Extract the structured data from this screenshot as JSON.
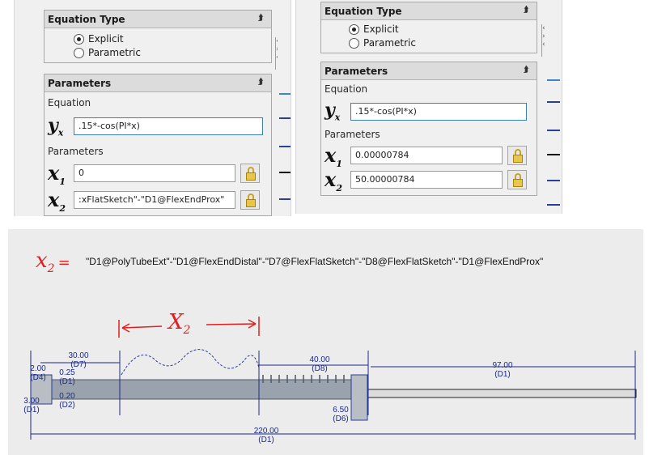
{
  "left_panel": {
    "equation_type": {
      "title": "Equation Type",
      "options": [
        {
          "label": "Explicit",
          "selected": true
        },
        {
          "label": "Parametric",
          "selected": false
        }
      ]
    },
    "parameters": {
      "title": "Parameters",
      "equation_label": "Equation",
      "y_symbol": "y",
      "y_sub": "x",
      "y_value": ".15*-cos(PI*x)",
      "parameters_label": "Parameters",
      "x_symbol": "x",
      "x1_sub": "1",
      "x1_value": "0",
      "x2_sub": "2",
      "x2_value": ":xFlatSketch\"-\"D1@FlexEndProx\""
    }
  },
  "right_panel": {
    "equation_type": {
      "title": "Equation Type",
      "options": [
        {
          "label": "Explicit",
          "selected": true
        },
        {
          "label": "Parametric",
          "selected": false
        }
      ]
    },
    "parameters": {
      "title": "Parameters",
      "equation_label": "Equation",
      "y_symbol": "y",
      "y_sub": "x",
      "y_value": ".15*-cos(PI*x)",
      "parameters_label": "Parameters",
      "x_symbol": "x",
      "x1_sub": "1",
      "x1_value": "0.00000784",
      "x2_sub": "2",
      "x2_value": "50.00000784"
    }
  },
  "drawing": {
    "annotation_label": "x",
    "annotation_sub": "2",
    "annotation_eq": "=",
    "formula": "\"D1@PolyTubeExt\"-\"D1@FlexEndDistal\"-\"D7@FlexFlatSketch\"-\"D8@FlexFlatSketch\"-\"D1@FlexEndProx\"",
    "span_label": "X",
    "span_sub": "2",
    "dimensions": [
      {
        "value": "30.00",
        "ref": "(D7)"
      },
      {
        "value": "40.00",
        "ref": "(D8)"
      },
      {
        "value": "97.00",
        "ref": "(D1)"
      },
      {
        "value": "220.00",
        "ref": "(D1)"
      },
      {
        "value": "2.00",
        "ref": "(D4)"
      },
      {
        "value": "0.25",
        "ref": "(D1)"
      },
      {
        "value": "0.20",
        "ref": "(D2)"
      },
      {
        "value": "3.00",
        "ref": "(D1)"
      },
      {
        "value": "6.50",
        "ref": "(D6)"
      }
    ],
    "colors": {
      "dimension": "#1b2a8a",
      "annotation": "#e02020",
      "part_fill": "#9aa3ad"
    }
  }
}
